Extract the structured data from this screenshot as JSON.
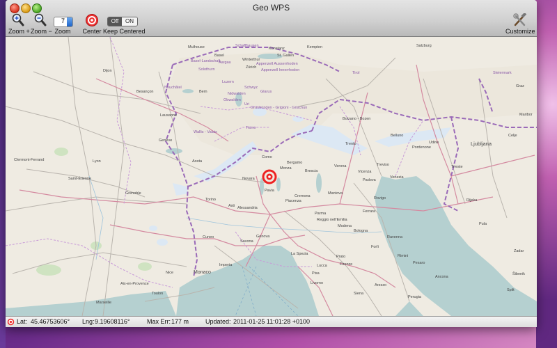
{
  "window": {
    "title": "Geo WPS"
  },
  "toolbar": {
    "zoom_in_label": "Zoom +",
    "zoom_out_label": "Zoom −",
    "zoom_label": "Zoom",
    "zoom_value": "7",
    "center_label": "Center",
    "keep_centered_label": "Keep Centered",
    "toggle_off": "Off",
    "toggle_on": "ON",
    "customize_label": "Customize"
  },
  "status": {
    "lat_label": "Lat:",
    "lat_value": "45.46753606°",
    "lng_label": "Lng:",
    "lng_value": "9.19608116°",
    "maxerr_label": "Max Err:",
    "maxerr_value": "177 m",
    "updated_label": "Updated:",
    "updated_value": "2011-01-25 11:01:28 +0100"
  },
  "map": {
    "labels": {
      "mulhouse": "Mulhouse",
      "basel": "Basel",
      "schaffhausen": "Schaffhausen",
      "winterthur": "Winterthur",
      "zurich": "Zürich",
      "stgallen": "St. Gallen",
      "konstanz": "Konstanz",
      "kempten": "Kempten",
      "salzburg": "Salzburg",
      "dijon": "Dijon",
      "besancon": "Besançon",
      "basellandschaft": "Basel-Landschaft",
      "solothurn": "Solothurn",
      "aargau": "Aargau",
      "appenzell1": "Appenzell Ausserrhoden",
      "appenzell2": "Appenzell Innerrhoden",
      "tirol": "Tirol",
      "steiermark": "Steiermark",
      "neuchatel": "Neuchâtel",
      "bern": "Bern",
      "luzern": "Luzern",
      "schwyz": "Schwyz",
      "nidwalden": "Nidwalden",
      "glarus": "Glarus",
      "obwalden": "Obwalden",
      "uri": "Uri",
      "graz": "Graz",
      "lausanne": "Lausanne",
      "graubunden": "Graubünden - Grigioni - Grischun",
      "wallis": "Wallis - Valais",
      "ticino": "Ticino",
      "bolzano": "Bolzano - Bozen",
      "maribor": "Maribor",
      "lyon": "Lyon",
      "geneve": "Genève",
      "aosta": "Aosta",
      "como": "Como",
      "bergamo": "Bergamo",
      "brescia": "Brescia",
      "trento": "Trento",
      "belluno": "Belluno",
      "pordenone": "Pordenone",
      "udine": "Udine",
      "celje": "Celje",
      "ljubljana": "Ljubljana",
      "clermont": "Clermont-Ferrand",
      "novara": "Novara",
      "monza": "Monza",
      "verona": "Verona",
      "vicenza": "Vicenza",
      "treviso": "Treviso",
      "trieste": "Trieste",
      "saintetienne": "Saint-Étienne",
      "padova": "Padova",
      "venezia": "Venezia",
      "grenoble": "Grenoble",
      "pavia": "Pavia",
      "cremona": "Cremona",
      "mantova": "Mantova",
      "torino": "Torino",
      "asti": "Asti",
      "alessandria": "Alessandria",
      "piacenza": "Piacenza",
      "rovigo": "Rovigo",
      "pula": "Pula",
      "parma": "Parma",
      "ferrara": "Ferrara",
      "reggio": "Reggio nell'Emilia",
      "cuneo": "Cuneo",
      "modena": "Modena",
      "bologna": "Bologna",
      "savona": "Savona",
      "genova": "Genova",
      "ravenna": "Ravenna",
      "forli": "Forlì",
      "rimini": "Rimini",
      "rijeka": "Rijeka",
      "zadar": "Zadar",
      "laspezia": "La Spezia",
      "prato": "Prato",
      "firenze": "Firenze",
      "pesaro": "Pesaro",
      "ancona": "Ancona",
      "monaco": "Monaco",
      "imperia": "Imperia",
      "nice": "Nice",
      "aixprovence": "Aix-en-Provence",
      "toulon": "Toulon",
      "lucca": "Lucca",
      "pisa": "Pisa",
      "livorno": "Livorno",
      "arezzo": "Arezzo",
      "perugia": "Perugia",
      "siena": "Siena",
      "marseille": "Marseille",
      "split": "Split",
      "sibenik": "Šibenik"
    }
  }
}
